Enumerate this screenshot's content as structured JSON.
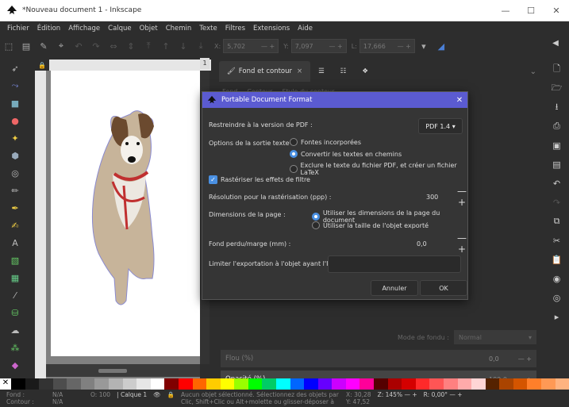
{
  "window": {
    "title": "*Nouveau document 1 - Inkscape",
    "controls": [
      "—",
      "☐",
      "✕"
    ]
  },
  "menu": [
    "Fichier",
    "Édition",
    "Affichage",
    "Calque",
    "Objet",
    "Chemin",
    "Texte",
    "Filtres",
    "Extensions",
    "Aide"
  ],
  "coords": {
    "x_label": "X:",
    "x_value": "5,702",
    "y_label": "Y:",
    "y_value": "7,097",
    "l_label": "L:",
    "l_value": "17,666"
  },
  "ruler_badge": "1",
  "dock": {
    "tabs": [
      {
        "label": "Fond et contour",
        "close": "×"
      }
    ],
    "sub_tabs": [
      "Fond",
      "Contour",
      "Style du contour"
    ],
    "blend_label": "Mode de fondu :",
    "blend_value": "Normal",
    "blur_label": "Flou (%)",
    "blur_value": "0,0",
    "opacity_label": "Opacité (%)",
    "opacity_value": "100,0"
  },
  "dialog": {
    "title": "Portable Document Format",
    "close": "✕",
    "restrict_label": "Restreindre à la version de PDF :",
    "pdf_version": "PDF 1.4",
    "text_output_label": "Options de la sortie texte :",
    "text_options": [
      {
        "label": "Fontes incorporées",
        "selected": false
      },
      {
        "label": "Convertir les textes en chemins",
        "selected": true
      },
      {
        "label": "Exclure le texte du fichier PDF, et créer un fichier LaTeX",
        "selected": false
      }
    ],
    "rasterize_label": "Rastériser les effets de filtre",
    "rasterize_checked": true,
    "resolution_label": "Résolution pour la rastérisation (ppp) :",
    "resolution_value": "300",
    "page_dims_label": "Dimensions de la page :",
    "page_options": [
      {
        "label": "Utiliser les dimensions de la page du document",
        "selected": true
      },
      {
        "label": "Utiliser la taille de l'objet exporté",
        "selected": false
      }
    ],
    "bleed_label": "Fond perdu/marge (mm) :",
    "bleed_value": "0,0",
    "limit_label": "Limiter l'exportation à l'objet ayant l'ID :",
    "limit_value": "",
    "cancel_label": "Annuler",
    "ok_label": "OK"
  },
  "status": {
    "fill_label": "Fond :",
    "fill_value": "N/A",
    "stroke_label": "Contour :",
    "stroke_value": "N/A",
    "o_label": "O:",
    "o_value": "100",
    "layer": "Calque 1",
    "message": "Aucun objet sélectionné. Sélectionnez des objets par",
    "message2": "Clic, Shift+Clic ou Alt+molette ou glisser-déposer à",
    "x_label": "X:",
    "x_value": "30,28",
    "y_label": "Y:",
    "y_value": "47,52",
    "z_label": "Z:",
    "zoom": "145%",
    "r_label": "R:",
    "rotation": "0,00°"
  },
  "palette": [
    "#000000",
    "#1a1a1a",
    "#333333",
    "#4d4d4d",
    "#666666",
    "#808080",
    "#999999",
    "#b3b3b3",
    "#cccccc",
    "#e6e6e6",
    "#ffffff",
    "#800000",
    "#ff0000",
    "#ff6600",
    "#ffcc00",
    "#ffff00",
    "#99ff00",
    "#00ff00",
    "#00cc66",
    "#00ffff",
    "#0066ff",
    "#0000ff",
    "#6600ff",
    "#cc00ff",
    "#ff00ff",
    "#ff0099",
    "#550000",
    "#aa0000",
    "#d40000",
    "#ff2a2a",
    "#ff5555",
    "#ff8080",
    "#ffaaaa",
    "#ffd5d5",
    "#552200",
    "#aa4400",
    "#d45500",
    "#ff7f2a",
    "#ff9955",
    "#ffb380"
  ]
}
